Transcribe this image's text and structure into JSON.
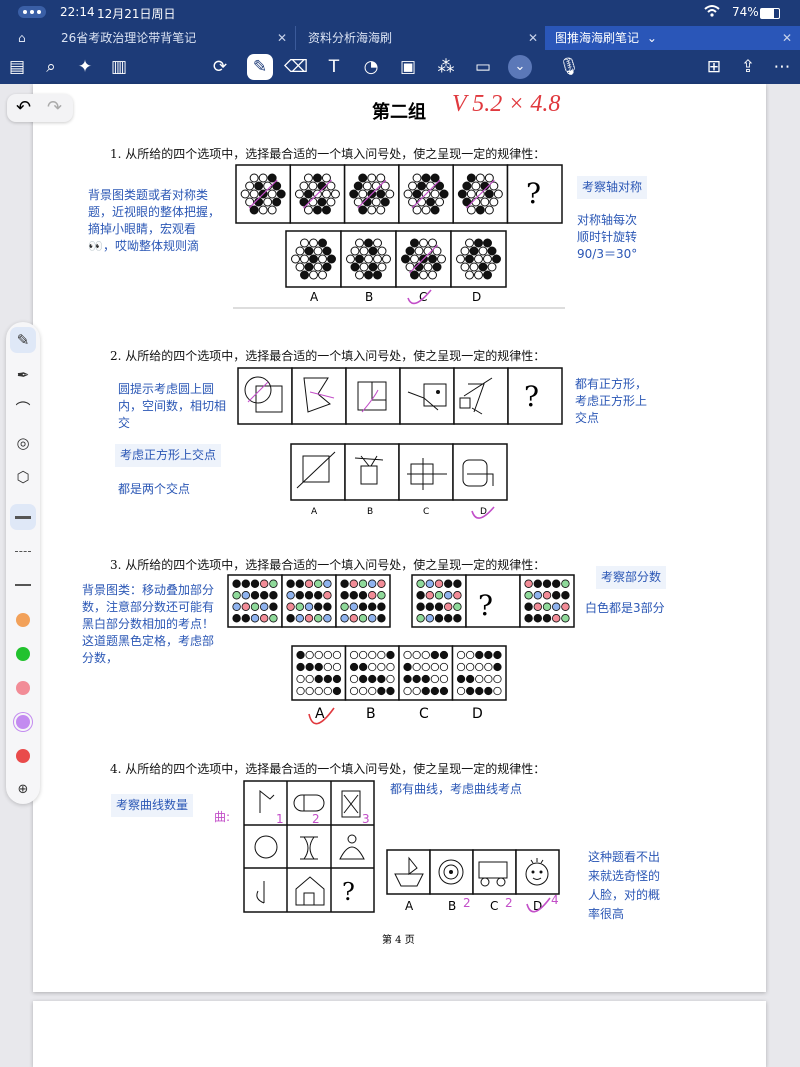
{
  "status": {
    "time": "22:14",
    "date": "12月21日周日",
    "battery": "74%"
  },
  "tabs": [
    {
      "label": "26省考政治理论带背笔记"
    },
    {
      "label": "资料分析海海刷"
    },
    {
      "label": "图推海海刷笔记"
    }
  ],
  "toolbar": {
    "icons": [
      "sidebar-icon",
      "search-icon",
      "sparkle-icon",
      "document-icon",
      "lasso-icon",
      "pen-icon",
      "eraser-icon",
      "textbox-icon",
      "shapes-icon",
      "image-icon",
      "sticker-icon",
      "note-icon",
      "chevron-down-icon",
      "mic-icon",
      "add-page-icon",
      "share-icon",
      "more-icon"
    ]
  },
  "page": {
    "title": "第二组",
    "handwritten_title": "V 5.2 × 4.8",
    "page_number": "第 4 页"
  },
  "questions": [
    {
      "number": "1.",
      "text": "从所给的四个选项中，选择最合适的一个填入问号处，使之呈现一定的规律性：",
      "options": [
        "A",
        "B",
        "C",
        "D"
      ],
      "question_mark": "?",
      "notes": {
        "left": "背景图类题或者对称类题，近视眼的整体把握，摘掉小眼睛，宏观看👀，哎呦整体规则滴",
        "right_tag": "考察轴对称",
        "right": "对称轴每次顺时针旋转90/3＝30°"
      }
    },
    {
      "number": "2.",
      "text": "从所给的四个选项中，选择最合适的一个填入问号处，使之呈现一定的规律性：",
      "options": [
        "A",
        "B",
        "C",
        "D"
      ],
      "question_mark": "?",
      "notes": {
        "left": "圆提示考虑圆上圆内，空间数，相切相交",
        "left_tag": "考虑正方形上交点",
        "left2": "都是两个交点",
        "right": "都有正方形，考虑正方形上交点"
      }
    },
    {
      "number": "3.",
      "text": "从所给的四个选项中，选择最合适的一个填入问号处，使之呈现一定的规律性：",
      "options": [
        "A",
        "B",
        "C",
        "D"
      ],
      "question_mark": "?",
      "notes": {
        "left": "背景图类：移动叠加部分数，注意部分数还可能有黑白部分数相加的考点！这道题黑色定格，考虑部分数，",
        "right_tag": "考察部分数",
        "right": "白色都是3部分"
      }
    },
    {
      "number": "4.",
      "text": "从所给的四个选项中，选择最合适的一个填入问号处，使之呈现一定的规律性：",
      "options": [
        "A",
        "B",
        "C",
        "D"
      ],
      "question_mark": "?",
      "notes": {
        "left_tag": "考察曲线数量",
        "left_mark": "曲:",
        "top": "都有曲线，考虑曲线考点",
        "right": "这种题看不出来就选奇怪的人脸，对的概率很高",
        "marks": [
          "1",
          "2",
          "3",
          "2",
          "2",
          "4"
        ]
      }
    }
  ],
  "colors": {
    "ink_blue": "#2b57b5",
    "ink_purple": "#c24ec8",
    "ink_red": "#e0393e",
    "header_blue": "#1d3b78"
  },
  "palette": [
    "#f2a15a",
    "#22c22e",
    "#f28c97",
    "#c38bf0",
    "#e94b4b"
  ]
}
